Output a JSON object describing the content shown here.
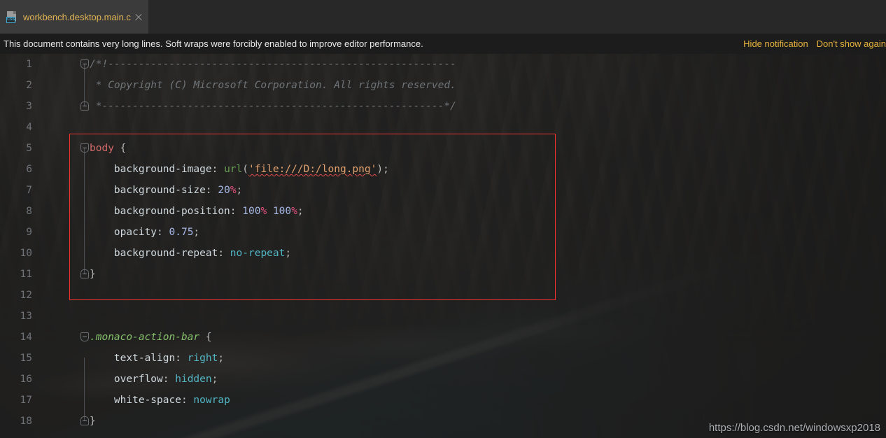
{
  "window": {
    "background_image_description": "dark coastal cliff photograph"
  },
  "tab_bar": {
    "tabs": [
      {
        "label": "workbench.desktop.main.css",
        "icon": "css-file-icon",
        "icon_badge": "CSS",
        "close_icon": "close-icon",
        "active": true
      }
    ]
  },
  "notification": {
    "message": "This document contains very long lines. Soft wraps were forcibly enabled to improve editor performance.",
    "actions": [
      {
        "label": "Hide notification"
      },
      {
        "label": "Don't show again"
      }
    ]
  },
  "editor": {
    "language": "css",
    "lines": [
      {
        "n": "1",
        "fold": "open",
        "guide": false
      },
      {
        "n": "2",
        "fold": "",
        "guide": true
      },
      {
        "n": "3",
        "fold": "close",
        "guide": false
      },
      {
        "n": "4",
        "fold": "",
        "guide": false
      },
      {
        "n": "5",
        "fold": "open",
        "guide": false
      },
      {
        "n": "6",
        "fold": "",
        "guide": true
      },
      {
        "n": "7",
        "fold": "",
        "guide": true
      },
      {
        "n": "8",
        "fold": "",
        "guide": true
      },
      {
        "n": "9",
        "fold": "",
        "guide": true
      },
      {
        "n": "10",
        "fold": "",
        "guide": true
      },
      {
        "n": "11",
        "fold": "close",
        "guide": false
      },
      {
        "n": "12",
        "fold": "",
        "guide": false
      },
      {
        "n": "13",
        "fold": "",
        "guide": false
      },
      {
        "n": "14",
        "fold": "open",
        "guide": false
      },
      {
        "n": "15",
        "fold": "",
        "guide": true
      },
      {
        "n": "16",
        "fold": "",
        "guide": true
      },
      {
        "n": "17",
        "fold": "",
        "guide": true
      },
      {
        "n": "18",
        "fold": "close",
        "guide": false
      }
    ],
    "code": {
      "line1": "/*!---------------------------------------------------------",
      "line2": " * Copyright (C) Microsoft Corporation. All rights reserved.",
      "line3": " *--------------------------------------------------------*/",
      "line4": "",
      "line5_selector": "body",
      "line5_brace": " {",
      "line6_prop": "background-image",
      "line6_func": "url",
      "line6_str": "'file:///D:/long.png'",
      "line7_prop": "background-size",
      "line7_num": "20",
      "line7_unit": "%",
      "line8_prop": "background-position",
      "line8_num1": "100",
      "line8_unit1": "%",
      "line8_num2": "100",
      "line8_unit2": "%",
      "line9_prop": "opacity",
      "line9_num": "0.75",
      "line10_prop": "background-repeat",
      "line10_kw": "no-repeat",
      "line11_brace": "}",
      "line14_selector": ".monaco-action-bar",
      "line14_brace": " {",
      "line15_prop": "text-align",
      "line15_kw": "right",
      "line16_prop": "overflow",
      "line16_kw": "hidden",
      "line17_prop": "white-space",
      "line17_kw": "nowrap",
      "line18_brace": "}"
    }
  },
  "annotation": {
    "red_box_color": "#f4322e"
  },
  "watermark": {
    "text": "https://blog.csdn.net/windowsxp2018"
  }
}
